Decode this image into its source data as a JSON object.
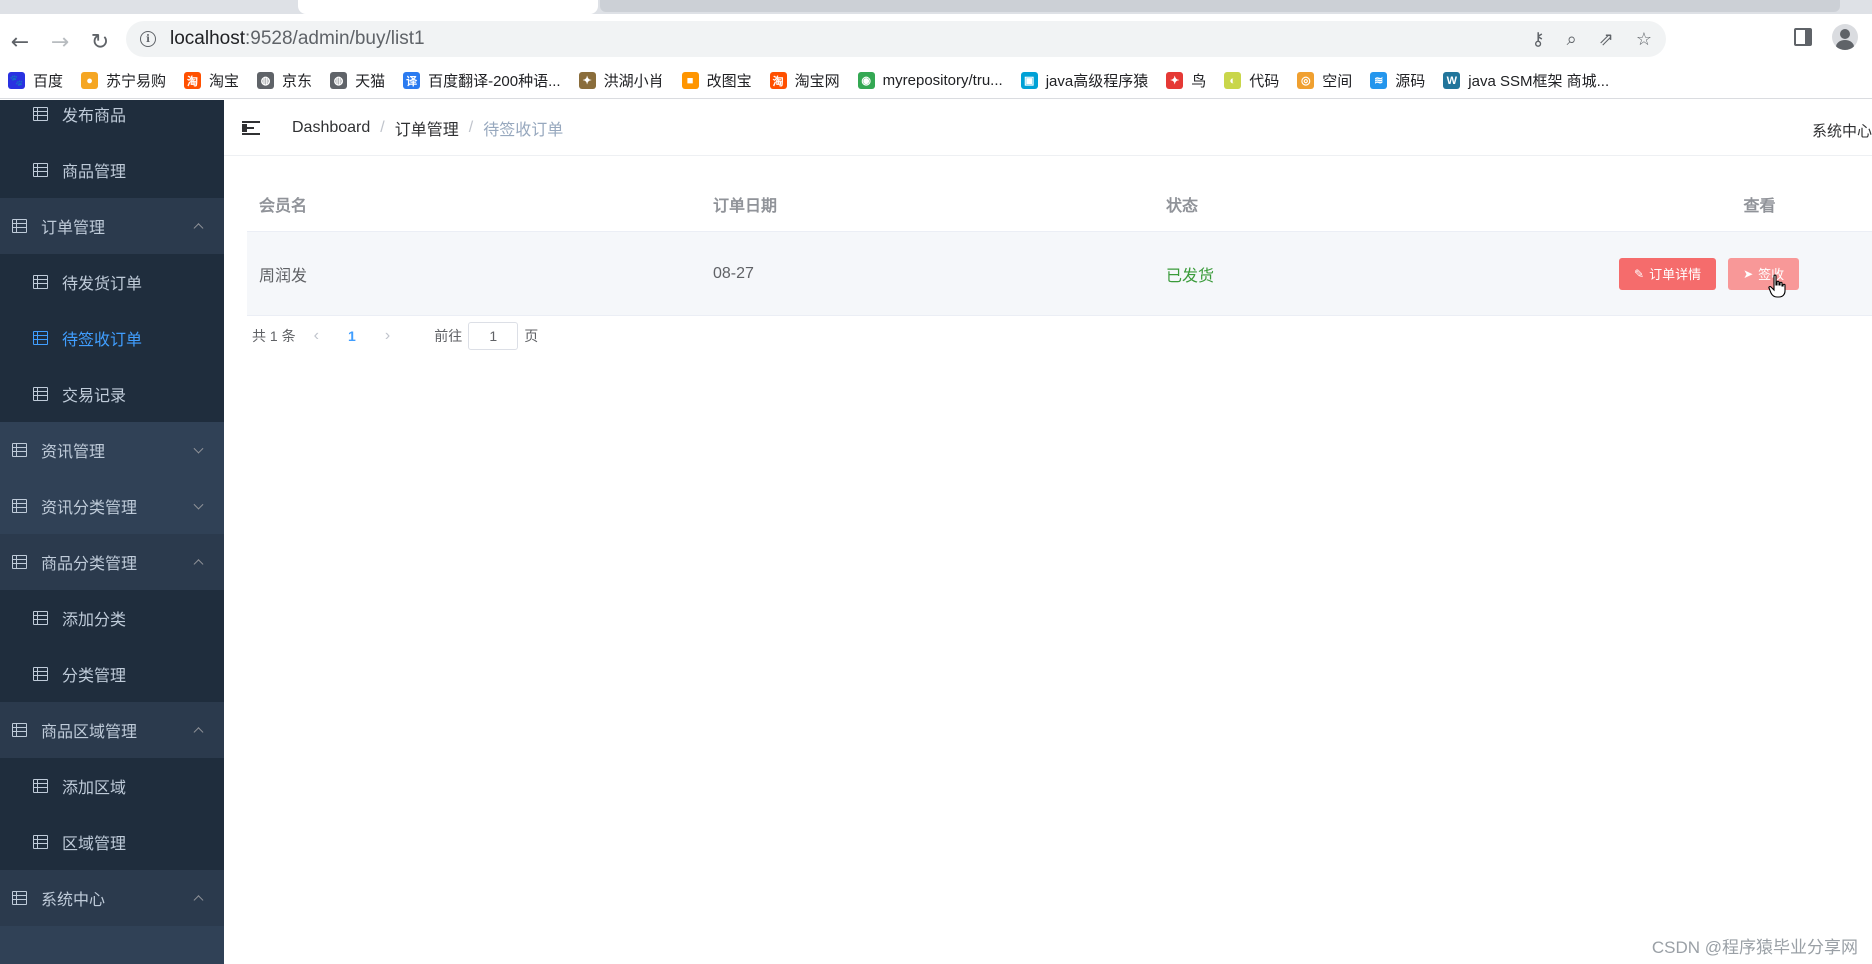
{
  "browser": {
    "url_host": "localhost",
    "url_path": ":9528/admin/buy/list1",
    "bookmarks": [
      {
        "label": "百度",
        "icon": "baidu-icon",
        "color": "#2932e1"
      },
      {
        "label": "苏宁易购",
        "icon": "suning-icon",
        "color": "#f5a623"
      },
      {
        "label": "淘宝",
        "icon": "taobao-icon",
        "color": "#ff5000"
      },
      {
        "label": "京东",
        "icon": "globe-icon",
        "color": "#5f6368"
      },
      {
        "label": "天猫",
        "icon": "globe-icon",
        "color": "#5f6368"
      },
      {
        "label": "百度翻译-200种语...",
        "icon": "translate-icon",
        "color": "#2b7bf0"
      },
      {
        "label": "洪湖小肖",
        "icon": "bird-icon",
        "color": "#8a6d3b"
      },
      {
        "label": "改图宝",
        "icon": "image-icon",
        "color": "#ff9500"
      },
      {
        "label": "淘宝网",
        "icon": "taobao-icon",
        "color": "#ff5000"
      },
      {
        "label": "myrepository/tru...",
        "icon": "chrome-icon",
        "color": "#34a853"
      },
      {
        "label": "java高级程序猿",
        "icon": "bilibili-icon",
        "color": "#00a1d6"
      },
      {
        "label": "鸟",
        "icon": "bird-icon",
        "color": "#e53935"
      },
      {
        "label": "代码",
        "icon": "code-icon",
        "color": "#c9d64a"
      },
      {
        "label": "空间",
        "icon": "space-icon",
        "color": "#f0a030"
      },
      {
        "label": "源码",
        "icon": "docker-icon",
        "color": "#2496ed"
      },
      {
        "label": "java SSM框架 商城...",
        "icon": "wordpress-icon",
        "color": "#21759b"
      }
    ]
  },
  "sidebar": {
    "items": [
      {
        "label": "发布商品",
        "level": "sub"
      },
      {
        "label": "商品管理",
        "level": "sub"
      },
      {
        "label": "订单管理",
        "level": "top",
        "expanded": true
      },
      {
        "label": "待发货订单",
        "level": "sub"
      },
      {
        "label": "待签收订单",
        "level": "sub",
        "active": true
      },
      {
        "label": "交易记录",
        "level": "sub"
      },
      {
        "label": "资讯管理",
        "level": "top",
        "expanded": false
      },
      {
        "label": "资讯分类管理",
        "level": "top",
        "expanded": false
      },
      {
        "label": "商品分类管理",
        "level": "top",
        "expanded": true
      },
      {
        "label": "添加分类",
        "level": "sub"
      },
      {
        "label": "分类管理",
        "level": "sub"
      },
      {
        "label": "商品区域管理",
        "level": "top",
        "expanded": true
      },
      {
        "label": "添加区域",
        "level": "sub"
      },
      {
        "label": "区域管理",
        "level": "sub"
      },
      {
        "label": "系统中心",
        "level": "top",
        "expanded": true
      }
    ]
  },
  "navbar": {
    "breadcrumb": [
      "Dashboard",
      "订单管理",
      "待签收订单"
    ],
    "right_label": "系统中心"
  },
  "table": {
    "columns": [
      "会员名",
      "订单日期",
      "状态",
      "查看"
    ],
    "rows": [
      {
        "member": "周润发",
        "date": "08-27",
        "status": "已发货"
      }
    ],
    "detail_button": "订单详情",
    "sign_button": "签收"
  },
  "pagination": {
    "total": "共 1 条",
    "current_page": "1",
    "goto_label": "前往",
    "goto_value": "1",
    "page_suffix": "页"
  },
  "watermark": "CSDN @程序猿毕业分享网",
  "colors": {
    "sidebar_bg": "#304156",
    "submenu_bg": "#1f2d3d",
    "active": "#409eff",
    "danger": "#f56c6c",
    "status_shipped": "#3a9b3a"
  }
}
